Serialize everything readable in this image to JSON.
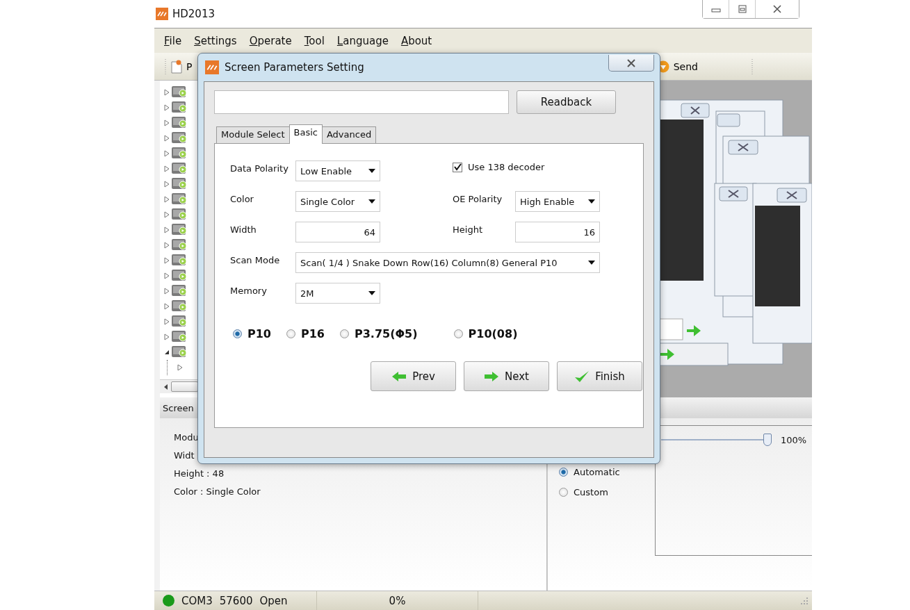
{
  "window": {
    "title": "HD2013"
  },
  "menu": [
    {
      "label": "File"
    },
    {
      "label": "Settings"
    },
    {
      "label": "Operate"
    },
    {
      "label": "Tool"
    },
    {
      "label": "Language"
    },
    {
      "label": "About"
    }
  ],
  "toolbar": [
    {
      "kind": "document",
      "label": "P"
    },
    {
      "kind": "send",
      "label": "Send"
    }
  ],
  "device_tree": [
    {
      "expanded": false
    },
    {
      "expanded": false
    },
    {
      "expanded": false
    },
    {
      "expanded": false
    },
    {
      "expanded": false
    },
    {
      "expanded": false
    },
    {
      "expanded": false
    },
    {
      "expanded": false
    },
    {
      "expanded": false
    },
    {
      "expanded": false
    },
    {
      "expanded": false
    },
    {
      "expanded": false
    },
    {
      "expanded": false
    },
    {
      "expanded": false
    },
    {
      "expanded": false
    },
    {
      "expanded": false
    },
    {
      "expanded": false
    },
    {
      "expanded": true,
      "children": [
        {
          "expanded": false
        }
      ]
    }
  ],
  "screen_info": {
    "tab": "Screen",
    "lines": [
      "Modu",
      "Widt",
      "Height : 48",
      "Color : Single Color"
    ]
  },
  "display_options": {
    "modes": [
      {
        "label": "Automatic",
        "selected": true
      },
      {
        "label": "Custom",
        "selected": false
      }
    ],
    "zoom": {
      "level": 0.97,
      "reading": "100%"
    }
  },
  "status_bar": {
    "connected": true,
    "port": "COM3",
    "baud": "57600",
    "state": "Open",
    "progress": "0%"
  },
  "dialog": {
    "title": "Screen Parameters Setting",
    "readback_button": "Readback",
    "tabs": [
      {
        "label": "Module Select",
        "selected": false
      },
      {
        "label": "Basic",
        "selected": true
      },
      {
        "label": "Advanced",
        "selected": false
      }
    ],
    "rows": [
      [
        {
          "kind": "select",
          "label": "Data Polarity",
          "value": "Low Enable"
        },
        {
          "kind": "checkbox",
          "label": "Use 138 decoder",
          "checked": true
        }
      ],
      [
        {
          "kind": "select",
          "label": "Color",
          "value": "Single Color"
        },
        {
          "kind": "select",
          "label": "OE Polarity",
          "value": "High Enable"
        }
      ],
      [
        {
          "kind": "number",
          "label": "Width",
          "value": "64"
        },
        {
          "kind": "number",
          "label": "Height",
          "value": "16"
        }
      ],
      [
        {
          "kind": "wide_select",
          "label": "Scan Mode",
          "value": "Scan( 1/4 ) Snake Down Row(16) Column(8) General P10"
        }
      ],
      [
        {
          "kind": "select",
          "label": "Memory",
          "value": "2M"
        }
      ]
    ],
    "pitch_options": [
      {
        "label": "P10",
        "selected": true
      },
      {
        "label": "P16",
        "selected": false
      },
      {
        "label": "P3.75(Φ5)",
        "selected": false
      },
      {
        "label": "P10(08)",
        "selected": false
      }
    ],
    "buttons": [
      {
        "kind": "prev",
        "label": "Prev"
      },
      {
        "kind": "next",
        "label": "Next"
      },
      {
        "kind": "finish",
        "label": "Finish"
      }
    ]
  }
}
